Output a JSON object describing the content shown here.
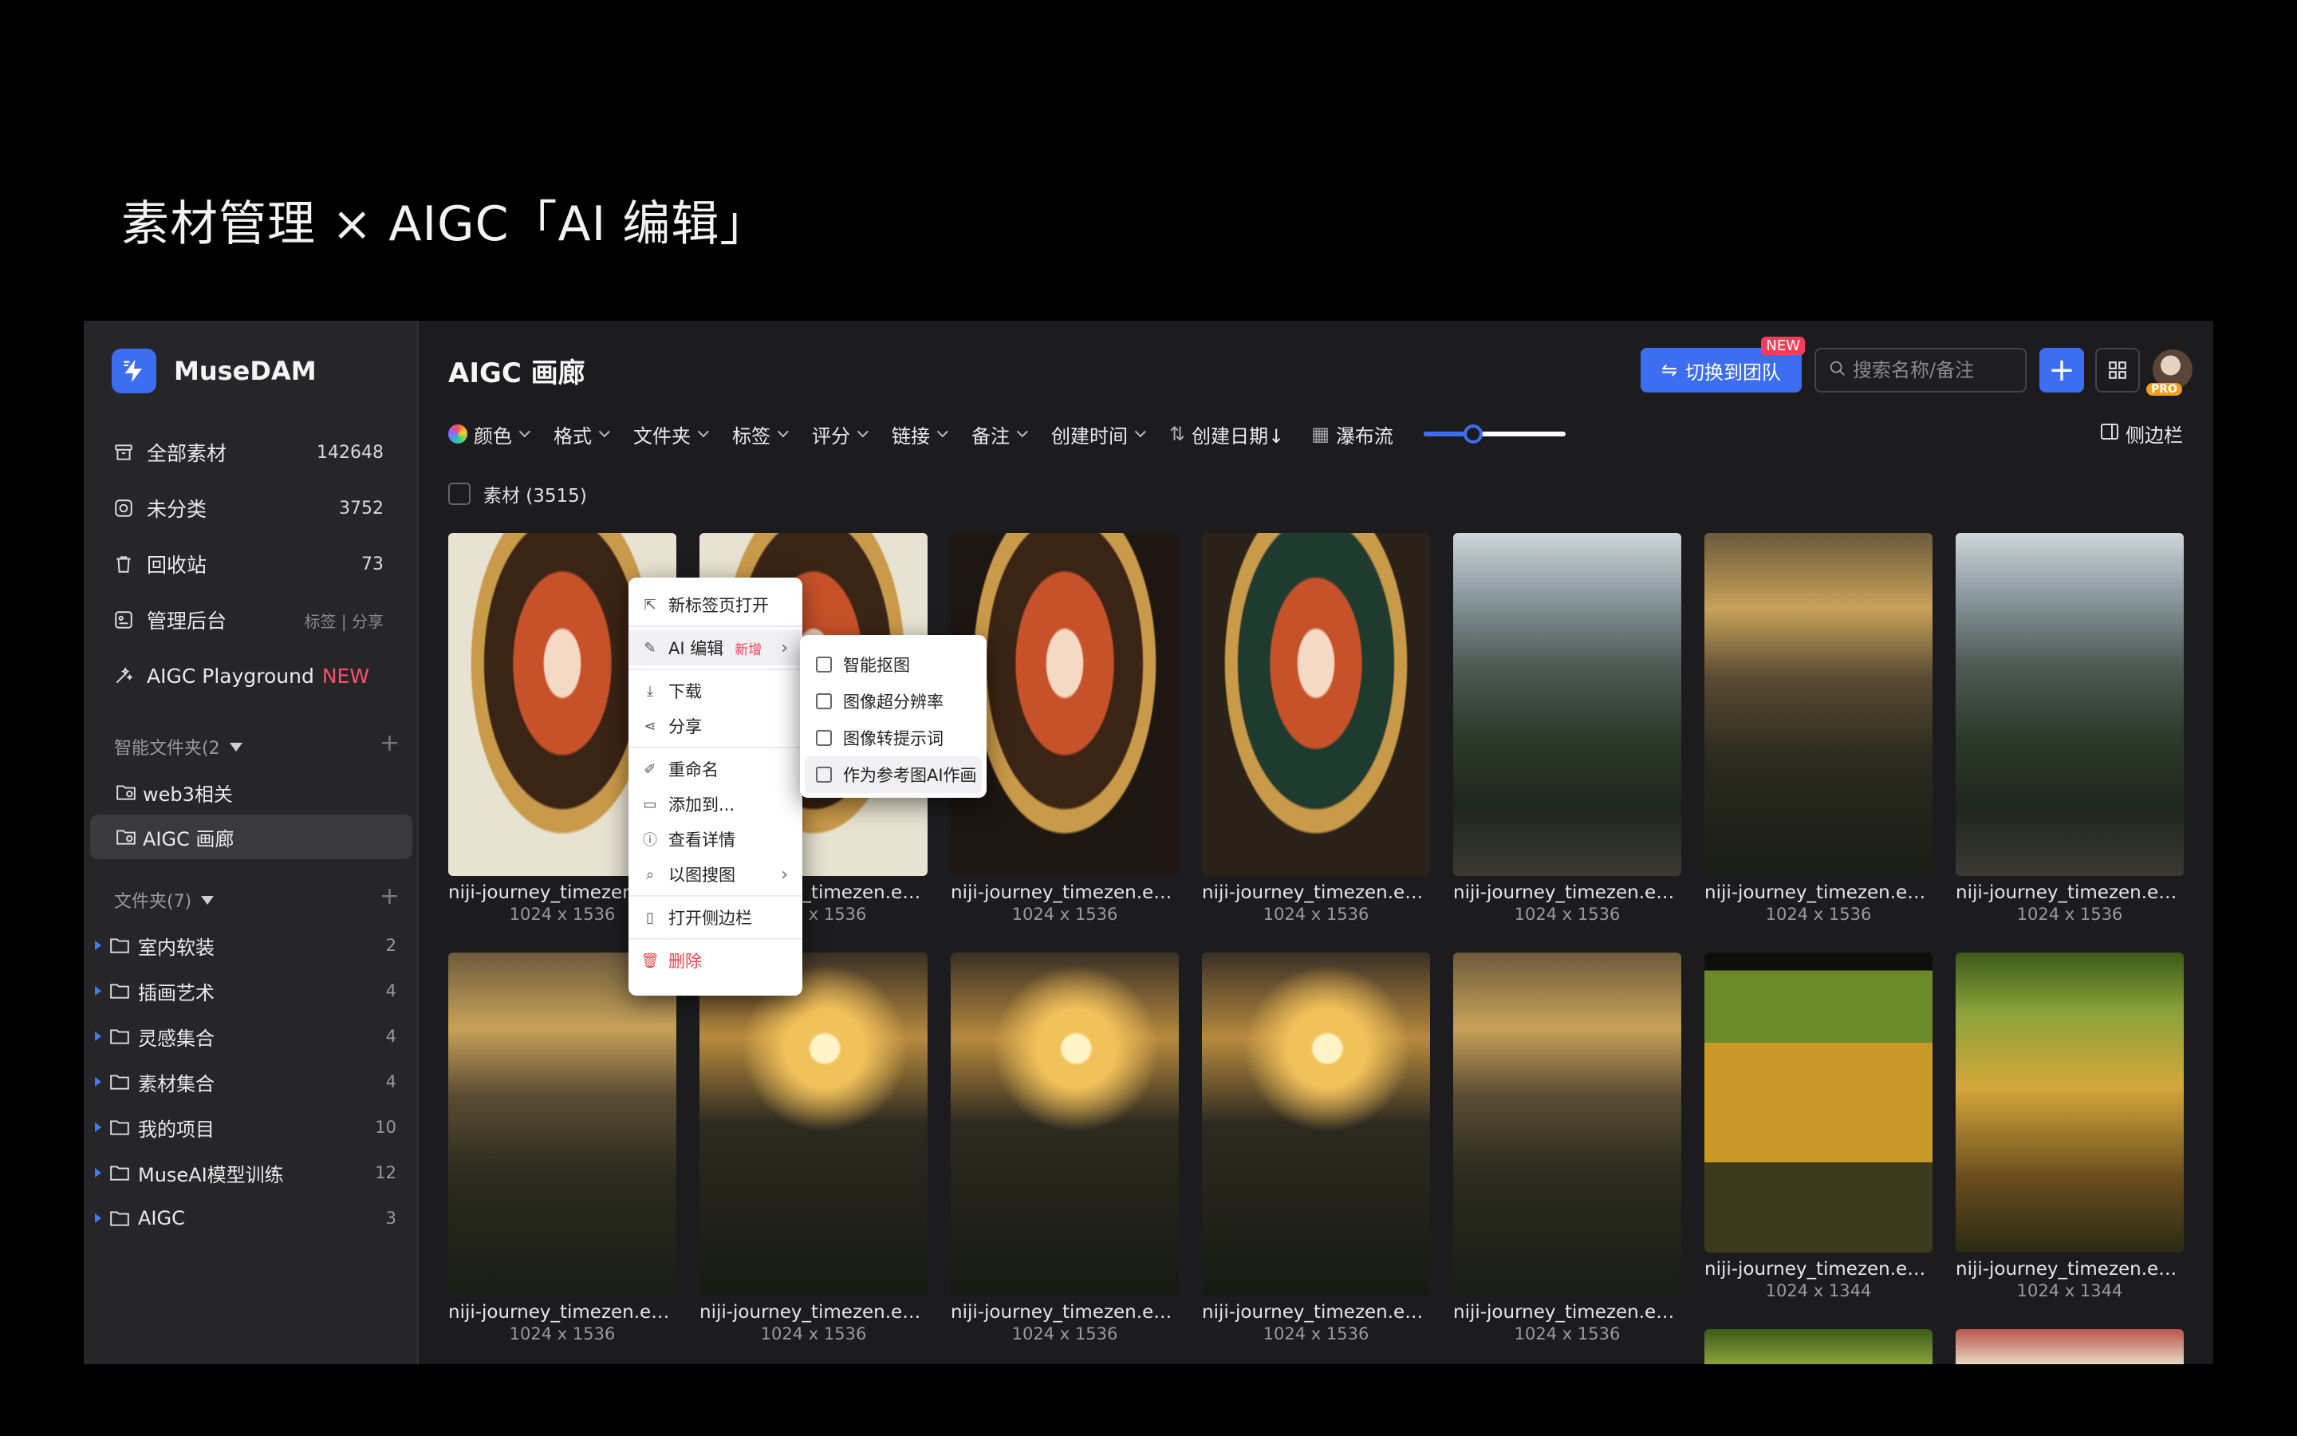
{
  "slide": {
    "title": "素材管理 × AIGC「AI 编辑」"
  },
  "brand": {
    "name": "MuseDAM"
  },
  "sidebar": {
    "nav": [
      {
        "label": "全部素材",
        "count": "142648"
      },
      {
        "label": "未分类",
        "count": "3752"
      },
      {
        "label": "回收站",
        "count": "73"
      },
      {
        "label": "管理后台",
        "meta": "标签 | 分享"
      },
      {
        "label": "AIGC Playground",
        "badge": "NEW"
      }
    ],
    "smart_header": "智能文件夹(2",
    "smart_folders": [
      {
        "label": "web3相关"
      },
      {
        "label": "AIGC 画廊"
      }
    ],
    "folders_header": "文件夹(7)",
    "folders": [
      {
        "label": "室内软装",
        "count": "2"
      },
      {
        "label": "插画艺术",
        "count": "4"
      },
      {
        "label": "灵感集合",
        "count": "4"
      },
      {
        "label": "素材集合",
        "count": "4"
      },
      {
        "label": "我的项目",
        "count": "10"
      },
      {
        "label": "MuseAI模型训练",
        "count": "12"
      },
      {
        "label": "AIGC",
        "count": "3"
      }
    ]
  },
  "main": {
    "title": "AIGC 画廊",
    "team_button": "切换到团队",
    "team_badge": "NEW",
    "search_placeholder": "搜索名称/备注",
    "pro_badge": "PRO",
    "filters": [
      "颜色",
      "格式",
      "文件夹",
      "标签",
      "评分",
      "链接",
      "备注",
      "创建时间"
    ],
    "sort_label": "创建日期↓",
    "layout_label": "瀑布流",
    "zoom_level": 0.35,
    "sidebar_toggle": "侧边栏",
    "select_all": "素材 (3515)"
  },
  "cards": [
    {
      "name": "niji-journey_timezen.eth...",
      "dim": "1024 x 1536"
    },
    {
      "name": "niji-journey_timezen.eth...",
      "dim": "1024 x 1536"
    },
    {
      "name": "niji-journey_timezen.eth...",
      "dim": "1024 x 1536"
    },
    {
      "name": "niji-journey_timezen.eth...",
      "dim": "1024 x 1536"
    },
    {
      "name": "niji-journey_timezen.eth...",
      "dim": "1024 x 1536"
    },
    {
      "name": "niji-journey_timezen.eth...",
      "dim": "1024 x 1536"
    },
    {
      "name": "niji-journey_timezen.eth...",
      "dim": "1024 x 1536"
    },
    {
      "name": "niji-journey_timezen.eth...",
      "dim": "1024 x 1536"
    },
    {
      "name": "niji-journey_timezen.eth...",
      "dim": "1024 x 1536"
    },
    {
      "name": "niji-journey_timezen.eth...",
      "dim": "1024 x 1536"
    },
    {
      "name": "niji-journey_timezen.eth...",
      "dim": "1024 x 1536"
    },
    {
      "name": "niji-journey_timezen.eth...",
      "dim": "1024 x 1536"
    },
    {
      "name": "niji-journey_timezen.eth...",
      "dim": "1024 x 1344"
    },
    {
      "name": "niji-journey_timezen.eth...",
      "dim": "1024 x 1344"
    }
  ],
  "context_menu": {
    "items": [
      {
        "label": "新标签页打开",
        "icon": "open-external-icon"
      },
      {
        "label": "AI 编辑",
        "tag": "新增",
        "icon": "magic-wand-icon"
      },
      {
        "label": "下载",
        "icon": "download-icon"
      },
      {
        "label": "分享",
        "icon": "share-icon"
      },
      {
        "label": "重命名",
        "icon": "pencil-icon"
      },
      {
        "label": "添加到...",
        "icon": "folder-add-icon"
      },
      {
        "label": "查看详情",
        "icon": "info-icon"
      },
      {
        "label": "以图搜图",
        "icon": "image-search-icon"
      },
      {
        "label": "打开侧边栏",
        "icon": "sidebar-icon"
      },
      {
        "label": "删除",
        "icon": "trash-icon"
      }
    ],
    "submenu": [
      {
        "label": "智能抠图"
      },
      {
        "label": "图像超分辨率"
      },
      {
        "label": "图像转提示词"
      },
      {
        "label": "作为参考图AI作画"
      }
    ]
  },
  "colors": {
    "accent": "#3d6df0",
    "danger": "#e5484d",
    "new": "#ff3b5c"
  }
}
